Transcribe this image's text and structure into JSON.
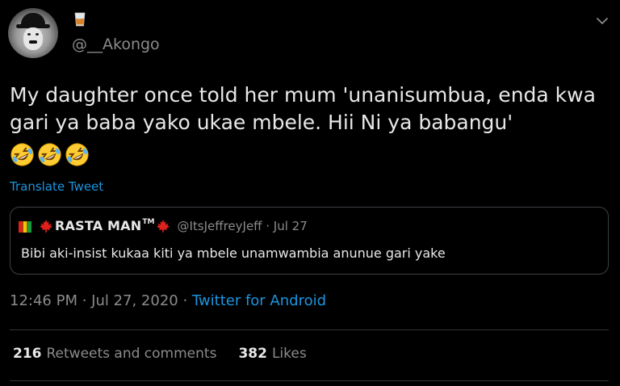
{
  "author": {
    "emoji": "🥃",
    "handle": "@__Akongo"
  },
  "tweet": {
    "text": "My daughter once told her mum 'unanisumbua, enda kwa gari ya baba yako ukae mbele. Hii Ni ya babangu'",
    "emoji": [
      "🤣",
      "🤣",
      "🤣"
    ],
    "translate_label": "Translate Tweet"
  },
  "quoted": {
    "name": "RASTA MAN",
    "tm": "TM",
    "handle": "@ItsJeffreyJeff",
    "date": "Jul 27",
    "meta": "@ItsJeffreyJeff · Jul 27",
    "text": "Bibi aki-insist kukaa kiti ya mbele unamwambia anunue gari yake"
  },
  "timestamp": {
    "time_date": "12:46 PM · Jul 27, 2020 · ",
    "source": "Twitter for Android"
  },
  "stats": {
    "retweets_count": "216",
    "retweets_label": "Retweets and comments",
    "likes_count": "382",
    "likes_label": "Likes"
  },
  "colors": {
    "background": "#000000",
    "text": "#e8e8e8",
    "muted": "#8b8b8b",
    "link": "#1b95e0",
    "border": "#3d4145"
  },
  "icons": {
    "menu": "chevron-down-icon",
    "laugh": "rolling-on-floor-laughing-emoji",
    "glass": "tumbler-glass-emoji",
    "maple": "maple-leaf-emoji",
    "rasta": "rasta-flag-emoji"
  }
}
